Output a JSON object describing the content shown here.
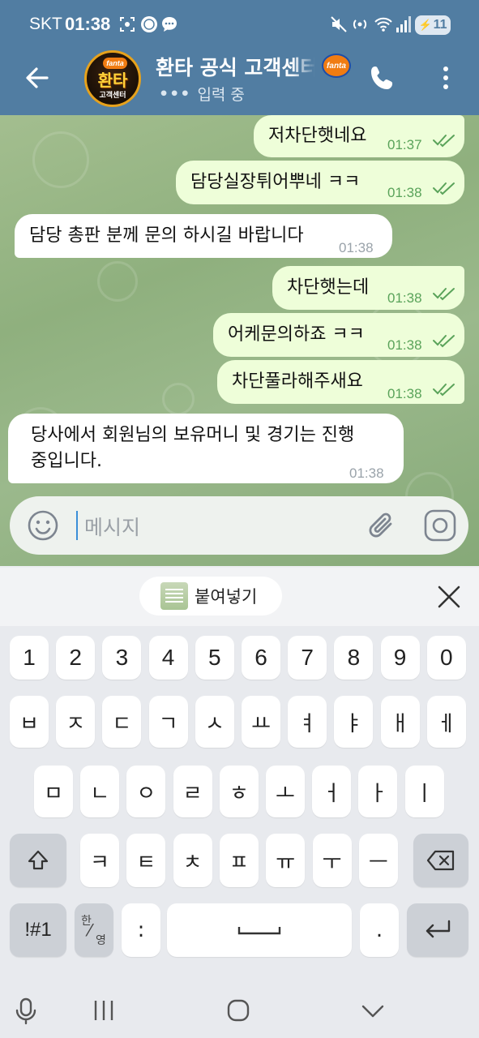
{
  "status_bar": {
    "carrier": "SKT",
    "time": "01:38",
    "battery": "11"
  },
  "header": {
    "avatar_brand": "fanta",
    "avatar_line1": "환타",
    "avatar_line2": "고객센터",
    "title": "환타 공식 고객센터",
    "badge": "fanta",
    "typing_status": "입력 중"
  },
  "messages": [
    {
      "dir": "out",
      "text": "저차단햇네요",
      "time": "01:37",
      "read": true
    },
    {
      "dir": "out",
      "text": "담당실장튀어뿌네 ㅋㅋ",
      "time": "01:38",
      "read": true
    },
    {
      "dir": "in",
      "text": "담당 총판 분께 문의 하시길 바랍니다",
      "time": "01:38"
    },
    {
      "dir": "out",
      "text": "차단햇는데",
      "time": "01:38",
      "read": true
    },
    {
      "dir": "out",
      "text": "어케문의하죠 ㅋㅋ",
      "time": "01:38",
      "read": true
    },
    {
      "dir": "out",
      "text": "차단풀라해주새요",
      "time": "01:38",
      "read": true
    },
    {
      "dir": "in",
      "text_line1": "당사에서 회원님의 보유머니 및 경기는 진행",
      "text_line2": "중입니다.",
      "time": "01:38"
    }
  ],
  "input": {
    "placeholder": "메시지"
  },
  "keyboard": {
    "paste_label": "붙여넣기",
    "row_numbers": [
      "1",
      "2",
      "3",
      "4",
      "5",
      "6",
      "7",
      "8",
      "9",
      "0"
    ],
    "row1": [
      "ㅂ",
      "ㅈ",
      "ㄷ",
      "ㄱ",
      "ㅅ",
      "ㅛ",
      "ㅕ",
      "ㅑ",
      "ㅐ",
      "ㅔ"
    ],
    "row2": [
      "ㅁ",
      "ㄴ",
      "ㅇ",
      "ㄹ",
      "ㅎ",
      "ㅗ",
      "ㅓ",
      "ㅏ",
      "ㅣ"
    ],
    "row3": [
      "ㅋ",
      "ㅌ",
      "ㅊ",
      "ㅍ",
      "ㅠ",
      "ㅜ",
      "ㅡ"
    ],
    "symbols_key": "!#1",
    "lang_top": "한",
    "lang_bottom": "영",
    "colon_key": ":",
    "period_key": "."
  },
  "colors": {
    "header": "#517da2",
    "outgoing_bubble": "#eefed9",
    "incoming_bubble": "#ffffff",
    "read_check": "#5aa35a"
  }
}
